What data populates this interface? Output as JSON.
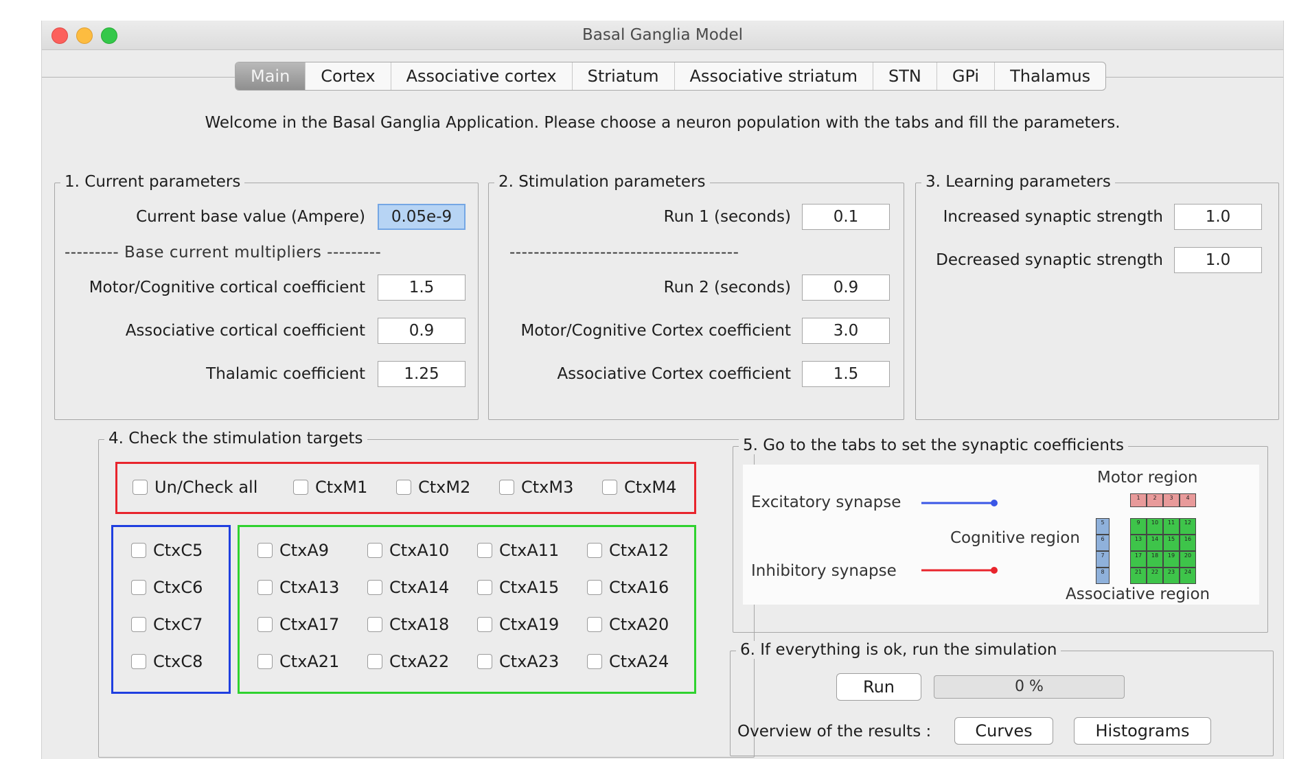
{
  "window": {
    "title": "Basal Ganglia Model"
  },
  "tabs": [
    "Main",
    "Cortex",
    "Associative cortex",
    "Striatum",
    "Associative striatum",
    "STN",
    "GPi",
    "Thalamus"
  ],
  "welcome": "Welcome in the Basal Ganglia Application. Please choose a neuron population with the tabs and fill the parameters.",
  "group1": {
    "legend": "1. Current parameters",
    "base_label": "Current base value (Ampere)",
    "base_value": "0.05e-9",
    "divider": "--------- Base current multipliers ---------",
    "motor_label": "Motor/Cognitive cortical coefficient",
    "motor_value": "1.5",
    "assoc_label": "Associative cortical coefficient",
    "assoc_value": "0.9",
    "thal_label": "Thalamic coefficient",
    "thal_value": "1.25"
  },
  "group2": {
    "legend": "2. Stimulation parameters",
    "run1_label": "Run 1 (seconds)",
    "run1_value": "0.1",
    "divider": "--------------------------------------",
    "run2_label": "Run 2 (seconds)",
    "run2_value": "0.9",
    "mc_label": "Motor/Cognitive Cortex coefficient",
    "mc_value": "3.0",
    "ac_label": "Associative Cortex coefficient",
    "ac_value": "1.5"
  },
  "group3": {
    "legend": "3. Learning parameters",
    "inc_label": "Increased synaptic strength",
    "inc_value": "1.0",
    "dec_label": "Decreased synaptic strength",
    "dec_value": "1.0"
  },
  "group4": {
    "legend": "4. Check the stimulation targets",
    "top_row": [
      "Un/Check all",
      "CtxM1",
      "CtxM2",
      "CtxM3",
      "CtxM4"
    ],
    "cognitive": [
      "CtxC5",
      "CtxC6",
      "CtxC7",
      "CtxC8"
    ],
    "associative": [
      [
        "CtxA9",
        "CtxA10",
        "CtxA11",
        "CtxA12"
      ],
      [
        "CtxA13",
        "CtxA14",
        "CtxA15",
        "CtxA16"
      ],
      [
        "CtxA17",
        "CtxA18",
        "CtxA19",
        "CtxA20"
      ],
      [
        "CtxA21",
        "CtxA22",
        "CtxA23",
        "CtxA24"
      ]
    ],
    "zone_colors": {
      "motor": "#e8242c",
      "cognitive": "#1f3fe0",
      "associative": "#2fd22f"
    }
  },
  "group5": {
    "legend": "5. Go to the tabs to set the synaptic coefficients",
    "excitatory": "Excitatory synapse",
    "inhibitory": "Inhibitory synapse",
    "motor_region": "Motor region",
    "cognitive_region": "Cognitive region",
    "associative_region": "Associative region",
    "motor_cells": [
      "1",
      "2",
      "3",
      "4"
    ],
    "cognitive_cells": [
      "5",
      "6",
      "7",
      "8"
    ],
    "assoc_cells": [
      "9",
      "10",
      "11",
      "12",
      "13",
      "14",
      "15",
      "16",
      "17",
      "18",
      "19",
      "20",
      "21",
      "22",
      "23",
      "24"
    ]
  },
  "group6": {
    "legend": "6. If everything is ok, run the simulation",
    "run_label": "Run",
    "progress_text": "0 %",
    "progress_value": 0,
    "overview_label": "Overview of the results :",
    "curves_label": "Curves",
    "histograms_label": "Histograms"
  }
}
